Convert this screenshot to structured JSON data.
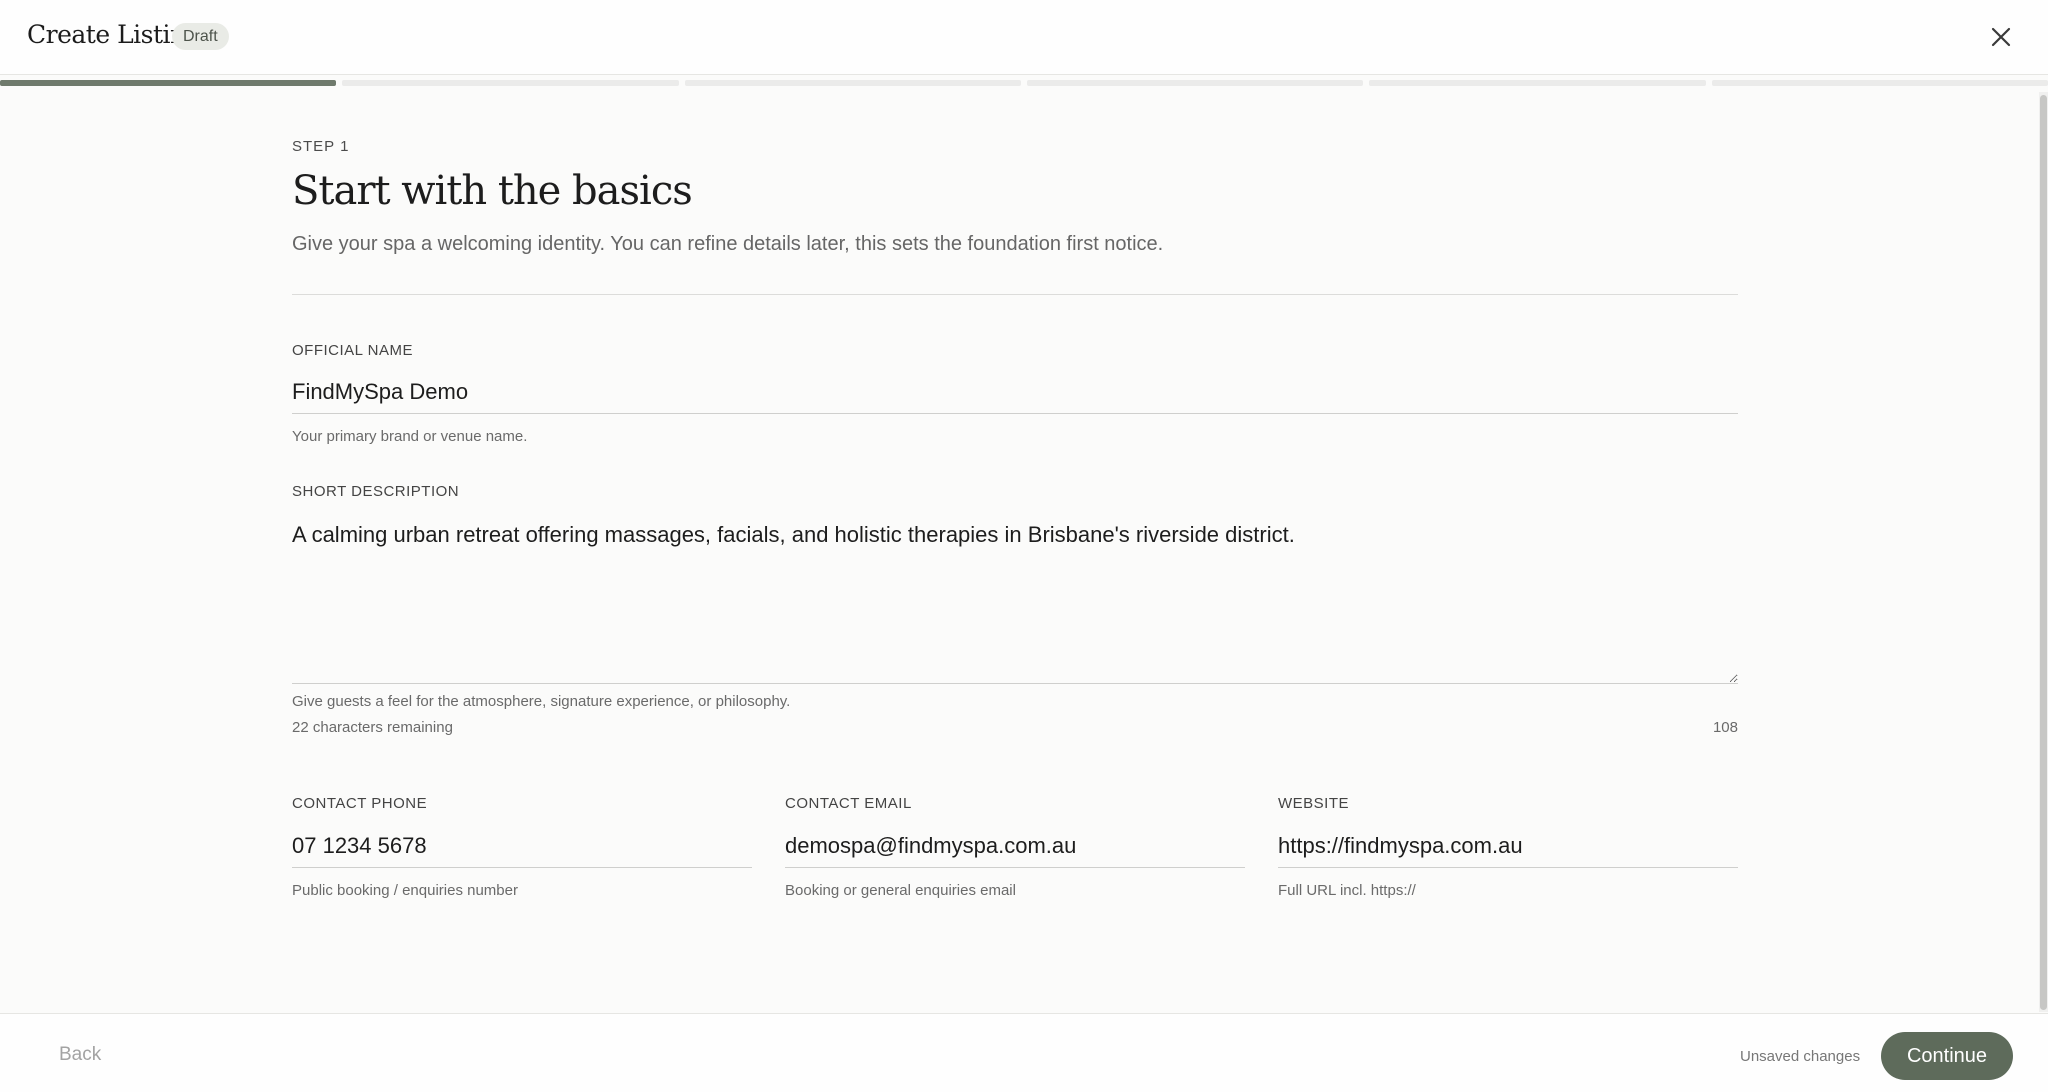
{
  "header": {
    "title": "Create Listing",
    "badge": "Draft"
  },
  "progress": {
    "total_steps": 6,
    "current_step": 1
  },
  "step": {
    "label": "STEP 1",
    "title": "Start with the basics",
    "subtitle": "Give your spa a welcoming identity. You can refine details later, this sets the foundation first notice."
  },
  "fields": {
    "official_name": {
      "label": "OFFICIAL NAME",
      "value": "FindMySpa Demo",
      "helper": "Your primary brand or venue name."
    },
    "short_description": {
      "label": "SHORT DESCRIPTION",
      "value": "A calming urban retreat offering massages, facials, and holistic therapies in Brisbane's riverside district.",
      "helper": "Give guests a feel for the atmosphere, signature experience, or philosophy.",
      "remaining": "22 characters remaining",
      "count": "108"
    },
    "contact_phone": {
      "label": "CONTACT PHONE",
      "value": "07 1234 5678",
      "helper": "Public booking / enquiries number"
    },
    "contact_email": {
      "label": "CONTACT EMAIL",
      "value": "demospa@findmyspa.com.au",
      "helper": "Booking or general enquiries email"
    },
    "website": {
      "label": "WEBSITE",
      "value": "https://findmyspa.com.au",
      "helper": "Full URL incl. https://"
    }
  },
  "footer": {
    "back_label": "Back",
    "status": "Unsaved changes",
    "continue_label": "Continue"
  },
  "colors": {
    "accent": "#5e6b5b",
    "progress_active": "#6f7a6c",
    "progress_inactive": "#ebebea",
    "background": "#fbfbfa"
  },
  "icons": {
    "close": "close-icon"
  }
}
